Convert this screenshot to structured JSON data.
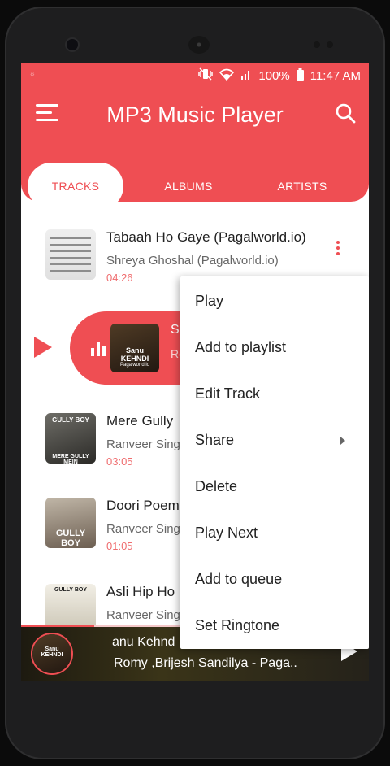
{
  "status_bar": {
    "left_icon": "notification-dot-icon",
    "icons": [
      "vibrate-icon",
      "wifi-icon",
      "signal-icon"
    ],
    "battery": "100%",
    "time": "11:47 AM"
  },
  "header": {
    "title": "MP3 Music Player",
    "menu_icon": "hamburger-menu-icon",
    "search_icon": "search-icon"
  },
  "tabs": [
    {
      "label": "TRACKS",
      "active": true
    },
    {
      "label": "ALBUMS",
      "active": false
    },
    {
      "label": "ARTISTS",
      "active": false
    }
  ],
  "tracks": [
    {
      "title": "Tabaah Ho Gaye (Pagalworld.io)",
      "artist": "Shreya Ghoshal (Pagalworld.io)",
      "duration": "04:26"
    },
    {
      "title": "Mere Gully",
      "artist": "Ranveer Singh",
      "duration": "03:05"
    },
    {
      "title": "Doori Poem",
      "artist": "Ranveer Singh",
      "duration": "01:05"
    },
    {
      "title": "Asli Hip Ho",
      "artist": "Ranveer Singh",
      "duration": ""
    }
  ],
  "now_playing_row": {
    "title": "Sa",
    "subtitle": "Ro",
    "art_text": "Sanu KEHNDI",
    "art_subtext": "Pagalworld.io"
  },
  "album_art_text": {
    "track2": "GULLY BOY",
    "track2b": "MERE GULLY MEIN",
    "track3": "GULLY BOY",
    "track4": "GULLY BOY"
  },
  "context_menu": {
    "items": [
      "Play",
      "Add to playlist",
      "Edit Track",
      "Share",
      "Delete",
      "Play Next",
      "Add to queue",
      "Set Ringtone"
    ],
    "submenu_item_index": 3
  },
  "mini_player": {
    "title": "anu Kehnd",
    "subtitle": "Romy ,Brijesh Sandilya - Paga..",
    "art_text": "Sanu KEHNDI",
    "progress_fraction": 0.21
  },
  "colors": {
    "accent": "#ef4e53"
  }
}
